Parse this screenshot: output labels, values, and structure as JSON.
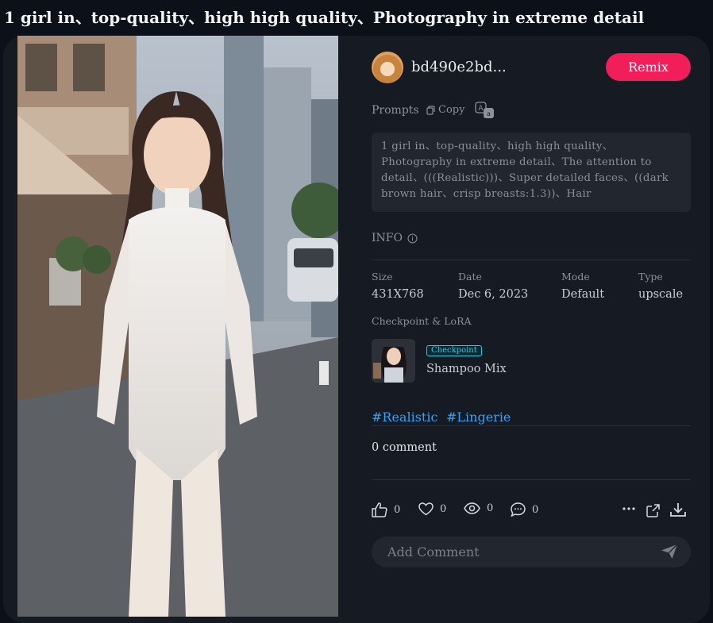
{
  "title": "1 girl in、top-quality、high high quality、Photography in extreme detail",
  "author": {
    "username": "bd490e2bd..."
  },
  "actions": {
    "remix_label": "Remix"
  },
  "prompts": {
    "label": "Prompts",
    "copy_label": "Copy",
    "text": "1 girl in、top-quality、high high quality、Photography in extreme detail、The attention to detail、(((Realistic)))、Super detailed faces、((dark brown hair、crisp breasts:1.3))、Hair"
  },
  "info": {
    "label": "INFO",
    "fields": [
      {
        "label": "Size",
        "value": "431X768"
      },
      {
        "label": "Date",
        "value": "Dec 6, 2023"
      },
      {
        "label": "Mode",
        "value": "Default"
      },
      {
        "label": "Type",
        "value": "upscale"
      }
    ]
  },
  "checkpoint": {
    "section_label": "Checkpoint & LoRA",
    "badge": "Checkpoint",
    "name": "Shampoo Mix"
  },
  "tags": [
    "#Realistic",
    "#Lingerie"
  ],
  "comments": {
    "count_label": "0 comment",
    "placeholder": "Add Comment"
  },
  "stats": {
    "likes": "0",
    "favorites": "0",
    "views": "0",
    "comments": "0"
  },
  "icons": {
    "translate": "translate-icon",
    "info": "info-icon",
    "like": "thumbs-up-icon",
    "favorite": "heart-icon",
    "views": "eye-icon",
    "comment": "chat-bubble-icon",
    "more": "more-horizontal-icon",
    "share": "external-link-icon",
    "download": "download-icon",
    "send": "send-icon"
  },
  "colors": {
    "accent": "#f21e5a",
    "tag": "#3aa0f2",
    "badge": "#33c6e0",
    "background": "#0b1019",
    "panel": "#161a22"
  }
}
